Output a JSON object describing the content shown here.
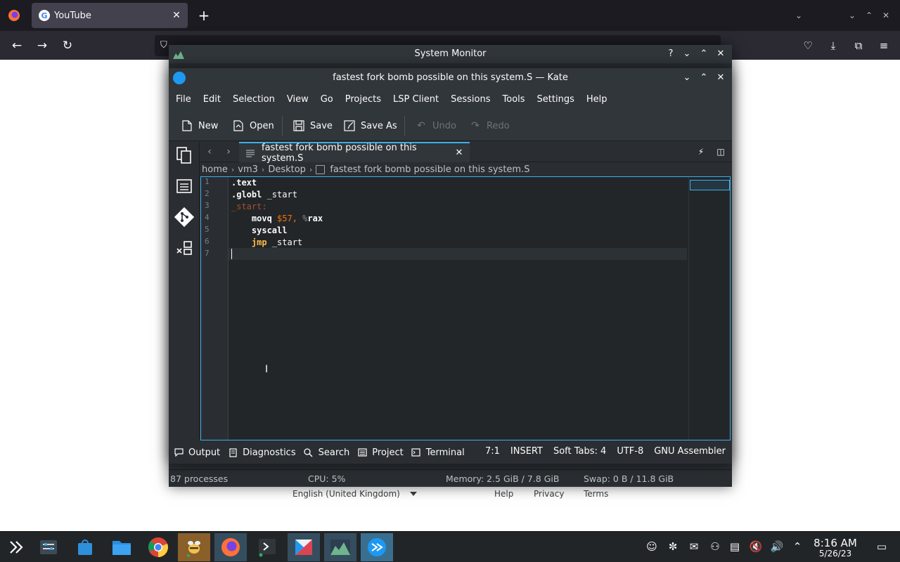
{
  "firefox": {
    "tab_title": "YouTube",
    "new_tab_label": "+",
    "tab_close": "✕"
  },
  "google_footer": {
    "language": "English (United Kingdom)",
    "help": "Help",
    "privacy": "Privacy",
    "terms": "Terms"
  },
  "sysmon": {
    "title": "System Monitor",
    "help": "?",
    "processes": "87 processes",
    "cpu": "CPU: 5%",
    "memory": "Memory: 2.5 GiB / 7.8 GiB",
    "swap": "Swap: 0 B / 11.8 GiB"
  },
  "kate": {
    "title": "fastest fork bomb possible on this system.S — Kate",
    "menu": [
      "File",
      "Edit",
      "Selection",
      "View",
      "Go",
      "Projects",
      "LSP Client",
      "Sessions",
      "Tools",
      "Settings",
      "Help"
    ],
    "toolbar": {
      "new": "New",
      "open": "Open",
      "save": "Save",
      "save_as": "Save As",
      "undo": "Undo",
      "redo": "Redo"
    },
    "tab_title": "fastest fork bomb possible on this system.S",
    "breadcrumb": [
      "home",
      "vm3",
      "Desktop",
      "fastest fork bomb possible on this system.S"
    ],
    "line_numbers": [
      "1",
      "2",
      "3",
      "4",
      "5",
      "6",
      "7"
    ],
    "code": {
      "l1": ".text",
      "l2_kw": ".globl",
      "l2_rest": " _start",
      "l3": "_start:",
      "l4_kw": "    movq",
      "l4_num": " $57,",
      "l4_pct": " %",
      "l4_reg": "rax",
      "l5": "    syscall",
      "l6_kw": "    jmp",
      "l6_rest": " _start"
    },
    "bottom": {
      "output": "Output",
      "diagnostics": "Diagnostics",
      "search": "Search",
      "project": "Project",
      "terminal": "Terminal",
      "cursor": "7:1",
      "mode": "INSERT",
      "tabs": "Soft Tabs: 4",
      "encoding": "UTF-8",
      "syntax": "GNU Assembler"
    }
  },
  "clock": {
    "time": "8:16 AM",
    "date": "5/26/23"
  },
  "colors": {
    "accent": "#3daee9",
    "window_bg": "#2a2e32",
    "editor_bg": "#232629",
    "number": "#f67400",
    "jmp_keyword": "#fdbc4b"
  }
}
